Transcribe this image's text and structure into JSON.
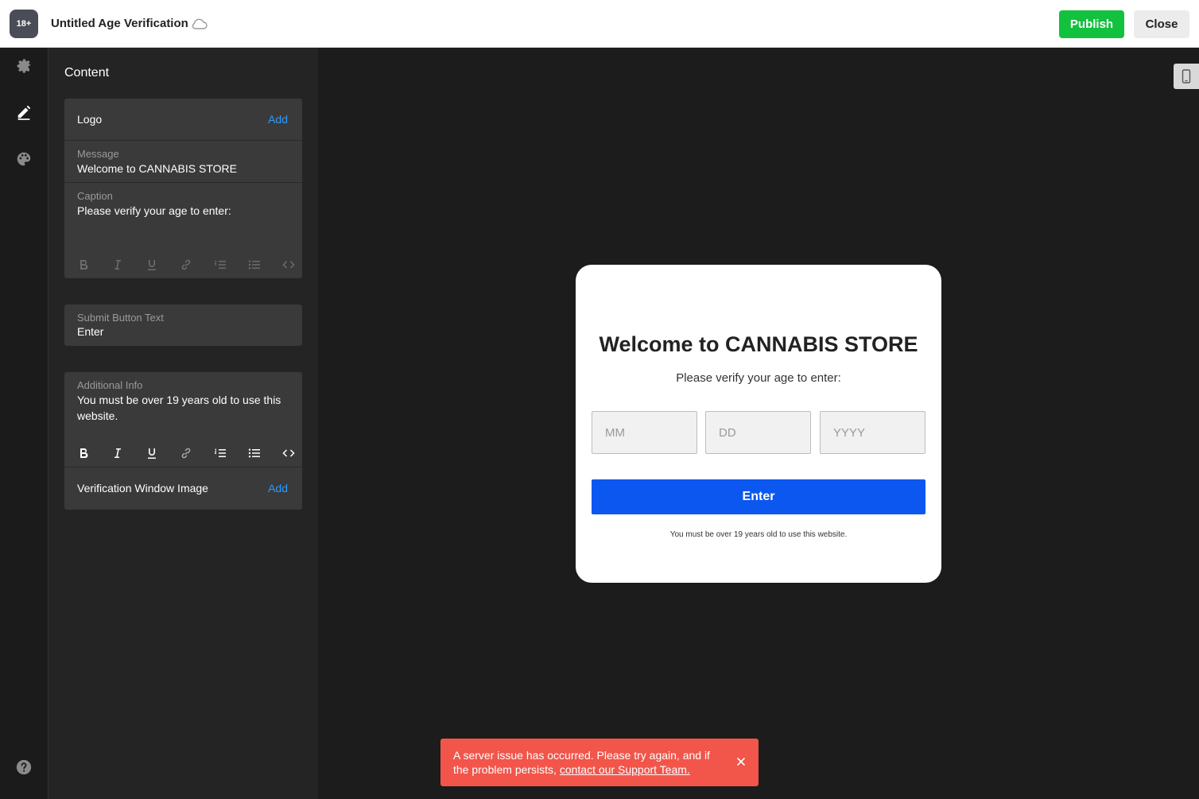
{
  "app": {
    "badge": "18+",
    "title": "Untitled Age Verification",
    "publish_label": "Publish",
    "close_label": "Close"
  },
  "panel": {
    "title": "Content",
    "logo_label": "Logo",
    "add_label": "Add",
    "message_label": "Message",
    "message_value": "Welcome to CANNABIS STORE",
    "caption_label": "Caption",
    "caption_value": "Please verify your age to enter:",
    "submit_label": "Submit Button Text",
    "submit_value": "Enter",
    "info_label": "Additional Info",
    "info_value": "You must be over 19 years old to use this website.",
    "image_label": "Verification Window Image"
  },
  "preview": {
    "title": "Welcome to CANNABIS STORE",
    "caption": "Please verify your age to enter:",
    "mm_placeholder": "MM",
    "dd_placeholder": "DD",
    "yyyy_placeholder": "YYYY",
    "button_label": "Enter",
    "info": "You must be over 19 years old to use this website."
  },
  "toast": {
    "message": "A server issue has occurred. Please try again, and if the problem persists,",
    "link": "contact our Support Team."
  },
  "colors": {
    "publish": "#12c13e",
    "accent_link": "#2f9bff",
    "preview_button": "#0b57f0",
    "toast": "#f2554a"
  },
  "icons": [
    "cloud-icon",
    "gear-icon",
    "pen-icon",
    "palette-icon",
    "help-icon",
    "mobile-icon",
    "close-icon"
  ]
}
